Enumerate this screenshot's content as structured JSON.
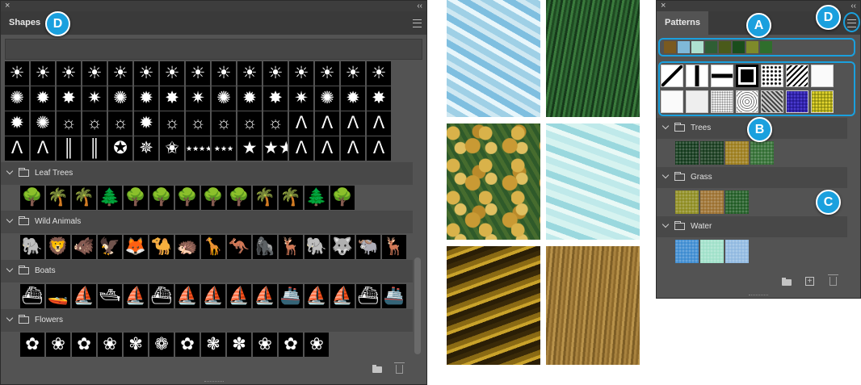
{
  "shapes_panel": {
    "close": "×",
    "collapse": "‹‹",
    "tab": "Shapes",
    "menu_icon": "menu-icon",
    "rows_top": [
      [
        "☀",
        "☀",
        "☀",
        "☀",
        "☀",
        "☀",
        "☀",
        "☀",
        "☀",
        "☀",
        "☀",
        "☀",
        "☀",
        "☀",
        "☀"
      ],
      [
        "✺",
        "✹",
        "✸",
        "✷",
        "✺",
        "✹",
        "✸",
        "✷",
        "✺",
        "✹",
        "✸",
        "✷",
        "✺",
        "✹",
        "✸"
      ],
      [
        "✹",
        "✺",
        "☼",
        "☼",
        "☼",
        "✹",
        "☼",
        "☼",
        "☼",
        "☼",
        "☼",
        "ᐱ",
        "ᐱ",
        "ᐱ",
        "ᐱ"
      ],
      [
        "ᐱ",
        "ᐱ",
        "║",
        "║",
        "✪",
        "✵",
        "✬",
        "★★★★",
        "★★★",
        "★",
        "★★",
        "ᐱ",
        "ᐱ",
        "ᐱ",
        "ᐱ"
      ]
    ],
    "groups": [
      {
        "label": "Leaf Trees",
        "icons": [
          "🌳",
          "🌴",
          "🌴",
          "🌲",
          "🌳",
          "🌳",
          "🌳",
          "🌳",
          "🌳",
          "🌴",
          "🌴",
          "🌲",
          "🌳"
        ]
      },
      {
        "label": "Wild Animals",
        "icons": [
          "🐘",
          "🦁",
          "🐗",
          "🦅",
          "🦊",
          "🐪",
          "🦔",
          "🦒",
          "🦘",
          "🦍",
          "🦌",
          "🐘",
          "🐺",
          "🐃",
          "🦌"
        ]
      },
      {
        "label": "Boats",
        "icons": [
          "⛴",
          "🚤",
          "⛵",
          "🛥",
          "⛵",
          "⛴",
          "⛵",
          "⛵",
          "⛵",
          "⛵",
          "🚢",
          "⛵",
          "⛵",
          "⛴",
          "🚢"
        ]
      },
      {
        "label": "Flowers",
        "icons": [
          "✿",
          "❀",
          "✿",
          "❀",
          "✾",
          "❁",
          "✿",
          "❃",
          "✽",
          "❀",
          "✿",
          "❀"
        ]
      }
    ],
    "callout": "D"
  },
  "previews": [
    {
      "name": "water-light"
    },
    {
      "name": "grass-dark"
    },
    {
      "name": "leaves"
    },
    {
      "name": "water-aqua"
    },
    {
      "name": "trees-aerial"
    },
    {
      "name": "dry-grass"
    }
  ],
  "patterns_panel": {
    "close": "×",
    "collapse": "‹‹",
    "tab": "Patterns",
    "menu_icon": "menu-icon",
    "recent_colors": [
      "#7a5a20",
      "#7fb8d8",
      "#aee0cf",
      "#2f5e34",
      "#4a5a1a",
      "#1a4d1c",
      "#7e8a2a",
      "#2f6e2c"
    ],
    "callouts": {
      "a": "A",
      "b": "B",
      "c": "C",
      "d": "D"
    },
    "groups": [
      {
        "label": "Trees",
        "colors": [
          "#0f3618",
          "#14381a",
          "#9a7a18",
          "#2e6b2f"
        ]
      },
      {
        "label": "Grass",
        "colors": [
          "#8c8a1e",
          "#9a6e2d",
          "#1e5a22"
        ]
      },
      {
        "label": "Water",
        "colors": [
          "#3b8ad0",
          "#9ee0c8",
          "#8fb8e0"
        ]
      }
    ]
  }
}
